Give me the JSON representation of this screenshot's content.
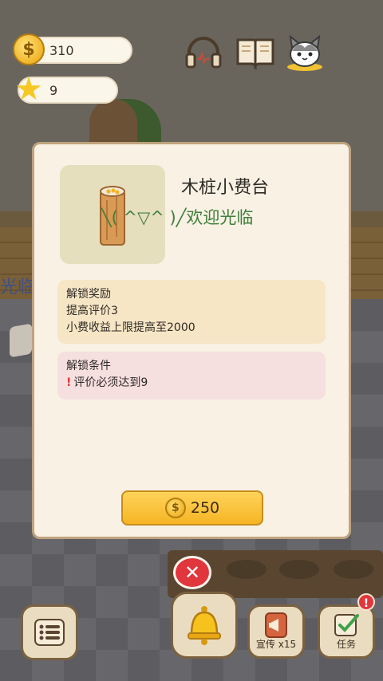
{
  "hud": {
    "coins": "310",
    "stars": "9",
    "coin_symbol": "$",
    "star_symbol": "★"
  },
  "background": {
    "side_sign_text": "光临"
  },
  "modal": {
    "item_title": "木桩小费台",
    "item_welcome": "╲( ^▽^ )╱欢迎光临",
    "reward_title": "解锁奖励",
    "reward_lines": [
      "提高评价3",
      "小费收益上限提高至2000"
    ],
    "condition_title": "解锁条件",
    "condition_mark": "!",
    "condition_line": "评价必须达到9",
    "price": "250",
    "price_coin_symbol": "$",
    "close_symbol": "✕"
  },
  "bottom_bar": {
    "promo_label": "宣传 x15",
    "task_label": "任务",
    "notify_badge": "!"
  },
  "colors": {
    "accent_gold": "#f5b524",
    "close_red": "#e0363c",
    "welcome_green": "#3f7f3a"
  },
  "icons": [
    "coin-icon",
    "star-icon",
    "headphones-icon",
    "book-icon",
    "cat-icon",
    "log-icon",
    "close-icon",
    "list-icon",
    "bell-icon",
    "megaphone-icon",
    "checklist-icon"
  ]
}
